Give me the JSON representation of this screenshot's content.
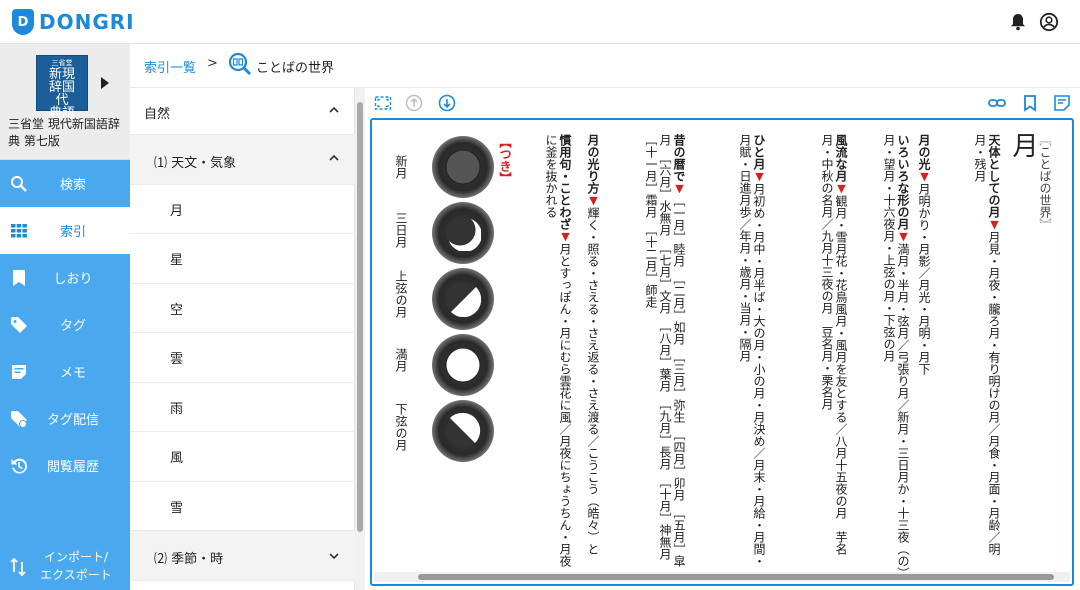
{
  "app": {
    "logo_letter": "D",
    "logo_text": "DONGRI",
    "accent": "#1a8ad9",
    "sidebar_color": "#4aa8ee"
  },
  "book": {
    "cover_small": "三省堂",
    "cover_big": "新現\n辞国代\n典語",
    "title": "三省堂 現代新国語辞典 第七版"
  },
  "nav": [
    {
      "label": "検索",
      "icon": "search-icon"
    },
    {
      "label": "索引",
      "icon": "grid-icon",
      "active": true
    },
    {
      "label": "しおり",
      "icon": "bookmark-icon"
    },
    {
      "label": "タグ",
      "icon": "tag-icon"
    },
    {
      "label": "メモ",
      "icon": "memo-icon"
    },
    {
      "label": "タグ配信",
      "icon": "tag-share-icon"
    },
    {
      "label": "閲覧履歴",
      "icon": "history-icon"
    }
  ],
  "nav_bottom": {
    "label": "インポート/\nエクスポート",
    "icon": "import-export-icon"
  },
  "breadcrumb": {
    "root": "索引一覧",
    "sep": ">",
    "current": "ことばの世界"
  },
  "tree": {
    "category": "自然",
    "sub1": "⑴ 天文・気象",
    "items": [
      "月",
      "星",
      "空",
      "雲",
      "雨",
      "風",
      "雪"
    ],
    "sub2": "⑵ 季節・時"
  },
  "content": {
    "section": "〖ことばの世界〗",
    "headword": "月",
    "tag": "【つき】",
    "columns": [
      {
        "head": "天体としての月",
        "body": "月見・月夜・朧ろ月・有り明けの月／月食・月面・月齢／明月・残月"
      },
      {
        "head": "月の光",
        "body": "月明かり・月影／月光・月明・月下"
      },
      {
        "head": "いろいろな形の月",
        "body": "満月・半月・弦月／弓張り月／新月・三日月か・十三夜（の）月・望月・十六夜月・上弦の月・下弦の月"
      },
      {
        "head": "風流な月",
        "body": "観月・雪月花・花鳥風月・風月を友とする／八月十五夜の月　芋名月・中秋の名月／九月十三夜の月　豆名月・栗名月"
      },
      {
        "head": "ひと月",
        "body": "月初め・月中・月半ば・大の月・小の月・月決め／月末・月給・月間・月賦・日進月歩／年月・歳月・当月・隔月"
      },
      {
        "head": "昔の暦で",
        "body": "［一月］睦月　［二月］如月　［三月］弥生　［四月］卯月　［五月］皐月　［六月］水無月　［七月］文月　［八月］葉月　［九月］長月　［十月］神無月　［十一月］霜月　［十二月］師走"
      },
      {
        "head": "月の光り方",
        "body": "輝く・照る・さえる・さえ返る・さえ渡る／こうこう（皓々）と"
      },
      {
        "head": "慣用句・ことわざ",
        "body": "月とすっぽん・月にむら雲花に風／月夜にちょうちん・月夜に釜を抜かれる"
      }
    ],
    "phases": [
      {
        "label": "新月",
        "icon": "new-moon-icon"
      },
      {
        "label": "三日月",
        "icon": "crescent-moon-icon"
      },
      {
        "label": "上弦の月",
        "icon": "first-quarter-moon-icon"
      },
      {
        "label": "満月",
        "icon": "full-moon-icon"
      },
      {
        "label": "下弦の月",
        "icon": "last-quarter-moon-icon"
      }
    ]
  }
}
